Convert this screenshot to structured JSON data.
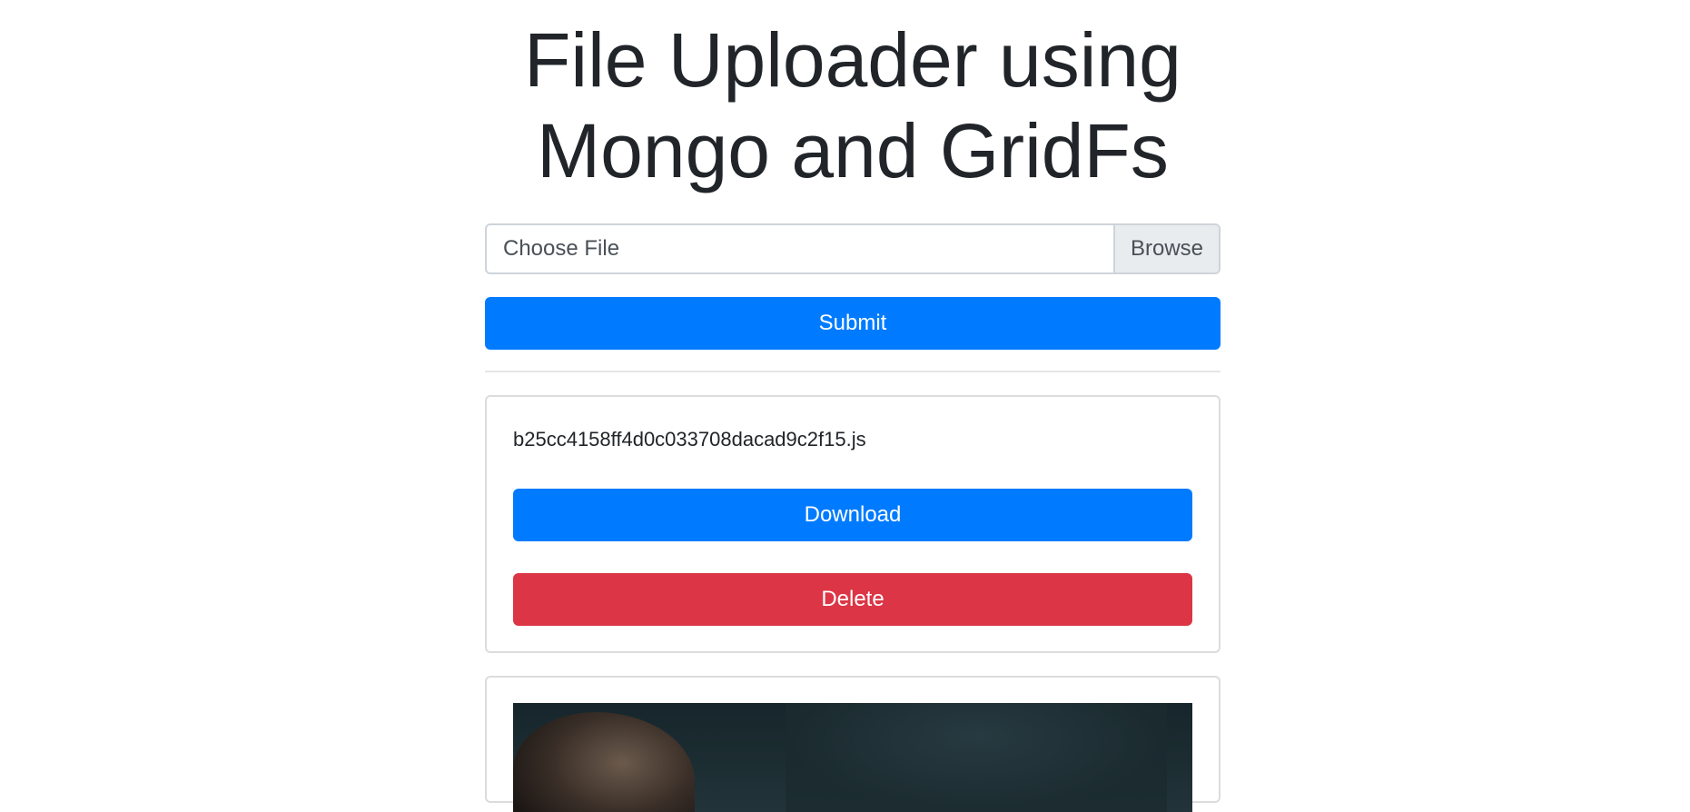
{
  "page": {
    "title_line1": "File Uploader using",
    "title_line2": "Mongo and GridFs"
  },
  "upload_form": {
    "file_placeholder": "Choose File",
    "browse_label": "Browse",
    "submit_label": "Submit"
  },
  "files": [
    {
      "filename": "b25cc4158ff4d0c033708dacad9c2f15.js",
      "download_label": "Download",
      "delete_label": "Delete"
    }
  ],
  "colors": {
    "primary": "#007bff",
    "danger": "#dc3545",
    "border": "#ced4da",
    "browse_bg": "#e9ecef"
  },
  "icons": []
}
